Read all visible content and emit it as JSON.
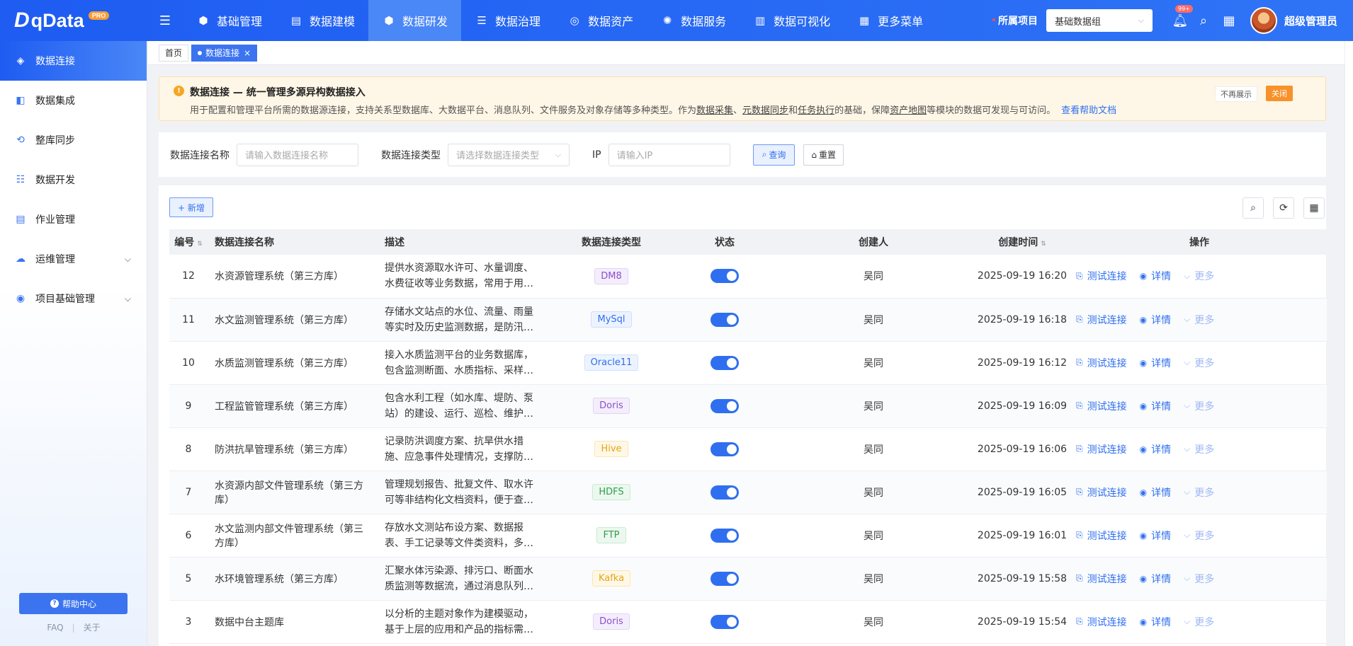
{
  "app": {
    "logo": "qData",
    "logo_badge": "PRO"
  },
  "topnav": [
    {
      "label": "基础管理",
      "icon": "cube-icon",
      "glyph": "⬢",
      "active": false
    },
    {
      "label": "数据建模",
      "icon": "book-icon",
      "glyph": "▤",
      "active": false
    },
    {
      "label": "数据研发",
      "icon": "cube-icon",
      "glyph": "⬢",
      "active": true
    },
    {
      "label": "数据治理",
      "icon": "database-icon",
      "glyph": "☰",
      "active": false
    },
    {
      "label": "数据资产",
      "icon": "target-icon",
      "glyph": "◎",
      "active": false
    },
    {
      "label": "数据服务",
      "icon": "service-icon",
      "glyph": "✺",
      "active": false
    },
    {
      "label": "数据可视化",
      "icon": "chart-icon",
      "glyph": "▥",
      "active": false
    },
    {
      "label": "更多菜单",
      "icon": "grid-icon",
      "glyph": "▦",
      "active": false
    }
  ],
  "top_right": {
    "project_label": "所属项目",
    "project_value": "基础数据组",
    "bell_badge": "99+",
    "username": "超级管理员"
  },
  "sidebar": {
    "items": [
      {
        "label": "数据连接",
        "icon": "connection-icon",
        "glyph": "◈",
        "active": true,
        "expandable": false
      },
      {
        "label": "数据集成",
        "icon": "integration-icon",
        "glyph": "◧",
        "active": false,
        "expandable": false
      },
      {
        "label": "整库同步",
        "icon": "sync-icon",
        "glyph": "⟲",
        "active": false,
        "expandable": false
      },
      {
        "label": "数据开发",
        "icon": "develop-icon",
        "glyph": "☷",
        "active": false,
        "expandable": false
      },
      {
        "label": "作业管理",
        "icon": "job-icon",
        "glyph": "▤",
        "active": false,
        "expandable": false
      },
      {
        "label": "运维管理",
        "icon": "cloud-icon",
        "glyph": "☁",
        "active": false,
        "expandable": true
      },
      {
        "label": "项目基础管理",
        "icon": "project-icon",
        "glyph": "◉",
        "active": false,
        "expandable": true
      }
    ],
    "help_button": "帮助中心",
    "faq": "FAQ",
    "sep": "|",
    "about": "关于"
  },
  "tabs": [
    {
      "label": "首页",
      "active": false
    },
    {
      "label": "数据连接",
      "active": true
    }
  ],
  "notice": {
    "title": "数据连接 — 统一管理多源异构数据接入",
    "text_prefix": "用于配置和管理平台所需的数据源连接，支持关系型数据库、大数据平台、消息队列、文件服务及对象存储等多种类型。作为",
    "link1": "数据采集",
    "sep1": "、",
    "link2": "元数据同步",
    "sep2": "和",
    "link3": "任务执行",
    "text_mid": "的基础，保障",
    "link4": "资产地图",
    "text_suffix": "等模块的数据可发现与可访问。",
    "help_link": "查看帮助文档",
    "hide_label": "不再展示",
    "close_label": "关闭"
  },
  "search": {
    "name_label": "数据连接名称",
    "name_placeholder": "请输入数据连接名称",
    "type_label": "数据连接类型",
    "type_placeholder": "请选择数据连接类型",
    "ip_label": "IP",
    "ip_placeholder": "请输入IP",
    "query_button": "查询",
    "reset_button": "重置"
  },
  "table": {
    "add_button": "+ 新增",
    "columns": {
      "id": "编号",
      "name": "数据连接名称",
      "desc": "描述",
      "type": "数据连接类型",
      "status": "状态",
      "creator": "创建人",
      "created_at": "创建时间",
      "ops": "操作"
    },
    "op_test": "测试连接",
    "op_detail": "详情",
    "op_more": "更多",
    "rows": [
      {
        "id": "12",
        "name": "水资源管理系统（第三方库）",
        "desc": "提供水资源取水许可、水量调度、水费征收等业务数据，常用于用水总量控制与考核",
        "type": "DM8",
        "type_color": "#8a4fc9",
        "type_bg": "#f4eefc",
        "type_border": "#e2d3f5",
        "status": true,
        "creator": "吴同",
        "created_at": "2025-09-19 16:20"
      },
      {
        "id": "11",
        "name": "水文监测管理系统（第三方库）",
        "desc": "存储水文站点的水位、流量、雨量等实时及历史监测数据，是防汛决策的重要依据",
        "type": "MySql",
        "type_color": "#2f6fef",
        "type_bg": "#edf3fe",
        "type_border": "#cfdffc",
        "status": true,
        "creator": "吴同",
        "created_at": "2025-09-19 16:18"
      },
      {
        "id": "10",
        "name": "水质监测管理系统（第三方库）",
        "desc": "接入水质监测平台的业务数据库，包含监测断面、水质指标、采样记录等信息",
        "type": "Oracle11",
        "type_color": "#2f6fef",
        "type_bg": "#edf3fe",
        "type_border": "#cfdffc",
        "status": true,
        "creator": "吴同",
        "created_at": "2025-09-19 16:12"
      },
      {
        "id": "9",
        "name": "工程监管管理系统（第三方库）",
        "desc": "包含水利工程（如水库、堤防、泵站）的建设、运行、巡检、维护等业务数据",
        "type": "Doris",
        "type_color": "#8a4fc9",
        "type_bg": "#f4eefc",
        "type_border": "#e2d3f5",
        "status": true,
        "creator": "吴同",
        "created_at": "2025-09-19 16:09"
      },
      {
        "id": "8",
        "name": "防洪抗旱管理系统（第三方库）",
        "desc": "记录防洪调度方案、抗旱供水措施、应急事件处理情况，支撑防汛抗旱指挥决策",
        "type": "Hive",
        "type_color": "#e6a417",
        "type_bg": "#fff8e6",
        "type_border": "#fbe6b3",
        "status": true,
        "creator": "吴同",
        "created_at": "2025-09-19 16:06"
      },
      {
        "id": "7",
        "name": "水资源内部文件管理系统（第三方库）",
        "desc": "管理规划报告、批复文件、取水许可等非结构化文档资料，便于查阅与归档管理",
        "type": "HDFS",
        "type_color": "#2f9e4a",
        "type_bg": "#ecf8ef",
        "type_border": "#c8ebd1",
        "status": true,
        "creator": "吴同",
        "created_at": "2025-09-19 16:05"
      },
      {
        "id": "6",
        "name": "水文监测内部文件管理系统（第三方库）",
        "desc": "存放水文测站布设方案、数据报表、手工记录等文件类资料，多种格式统一存储",
        "type": "FTP",
        "type_color": "#2f9e4a",
        "type_bg": "#ecf8ef",
        "type_border": "#c8ebd1",
        "status": true,
        "creator": "吴同",
        "created_at": "2025-09-19 16:01"
      },
      {
        "id": "5",
        "name": "水环境管理系统（第三方库）",
        "desc": "汇聚水体污染源、排污口、断面水质监测等数据流，通过消息队列实时推送",
        "type": "Kafka",
        "type_color": "#e6a417",
        "type_bg": "#fff8e6",
        "type_border": "#fbe6b3",
        "status": true,
        "creator": "吴同",
        "created_at": "2025-09-19 15:58"
      },
      {
        "id": "3",
        "name": "数据中台主题库",
        "desc": "以分析的主题对象作为建模驱动，基于上层的应用和产品的指标需求进行构建",
        "type": "Doris",
        "type_color": "#8a4fc9",
        "type_bg": "#f4eefc",
        "type_border": "#e2d3f5",
        "status": true,
        "creator": "吴同",
        "created_at": "2025-09-19 15:54"
      }
    ]
  }
}
